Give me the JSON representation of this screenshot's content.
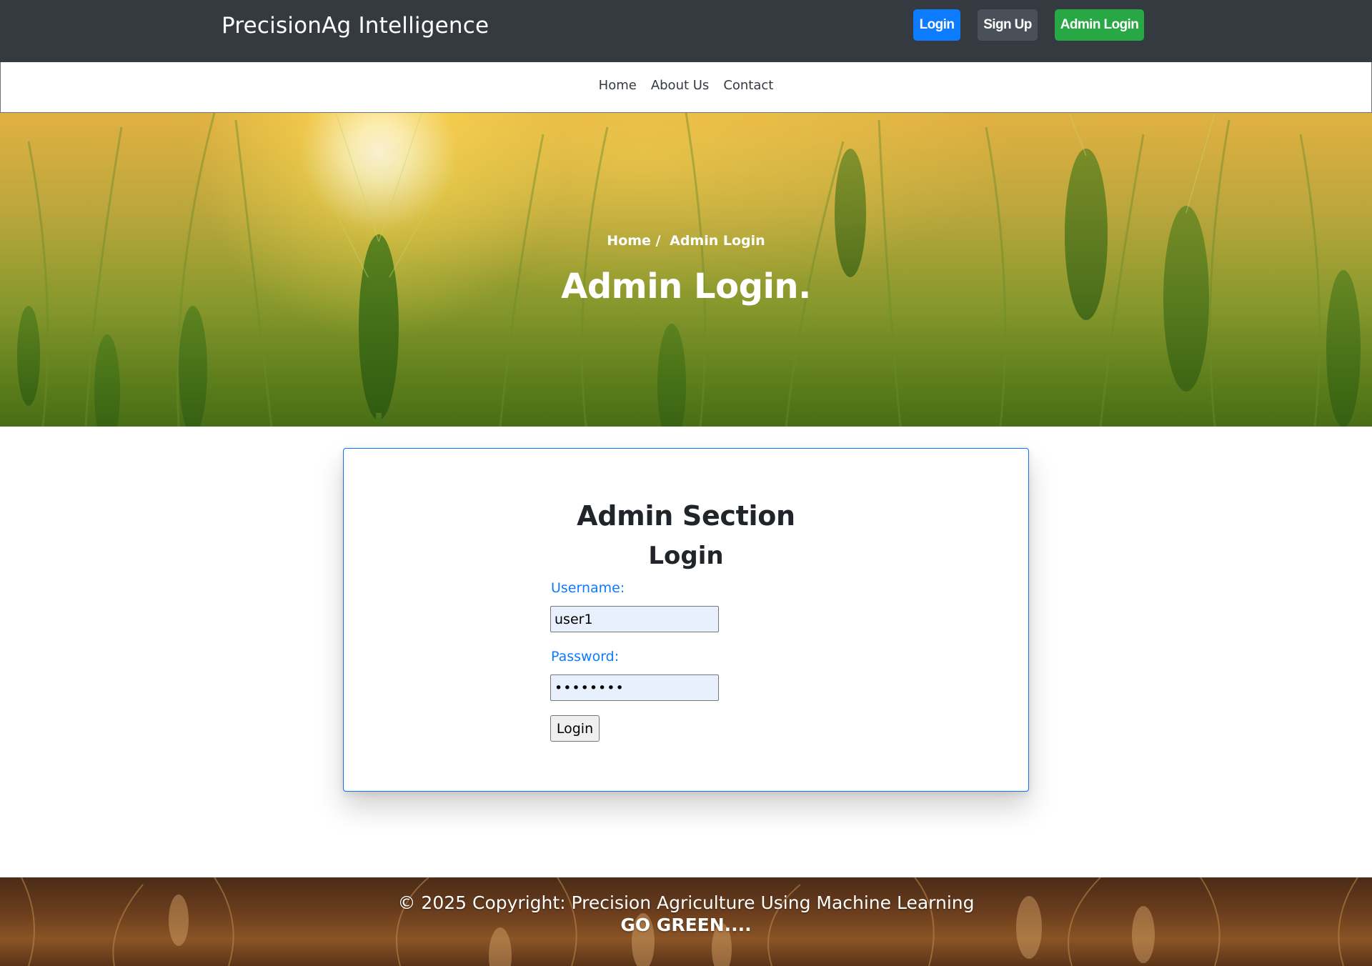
{
  "header": {
    "brand": "PrecisionAg Intelligence",
    "buttons": {
      "login": "Login",
      "signup": "Sign Up",
      "admin_login": "Admin Login"
    }
  },
  "nav": {
    "items": [
      {
        "label": "Home"
      },
      {
        "label": "About Us"
      },
      {
        "label": "Contact"
      }
    ]
  },
  "hero": {
    "breadcrumb": {
      "home": "Home /",
      "current": "Admin Login"
    },
    "title": "Admin Login."
  },
  "card": {
    "title": "Admin Section",
    "subtitle": "Login",
    "username_label": "Username:",
    "username_value": "user1",
    "password_label": "Password:",
    "password_value": "••••••••",
    "submit_label": "Login"
  },
  "footer": {
    "copyright": "© 2025 Copyright: Precision Agriculture Using Machine Learning",
    "tagline": "GO GREEN...."
  },
  "colors": {
    "topbar": "#343a40",
    "login_button": "#0d7bfd",
    "signup_button": "#495057",
    "admin_button": "#28a745",
    "accent": "#0d7bfd"
  }
}
